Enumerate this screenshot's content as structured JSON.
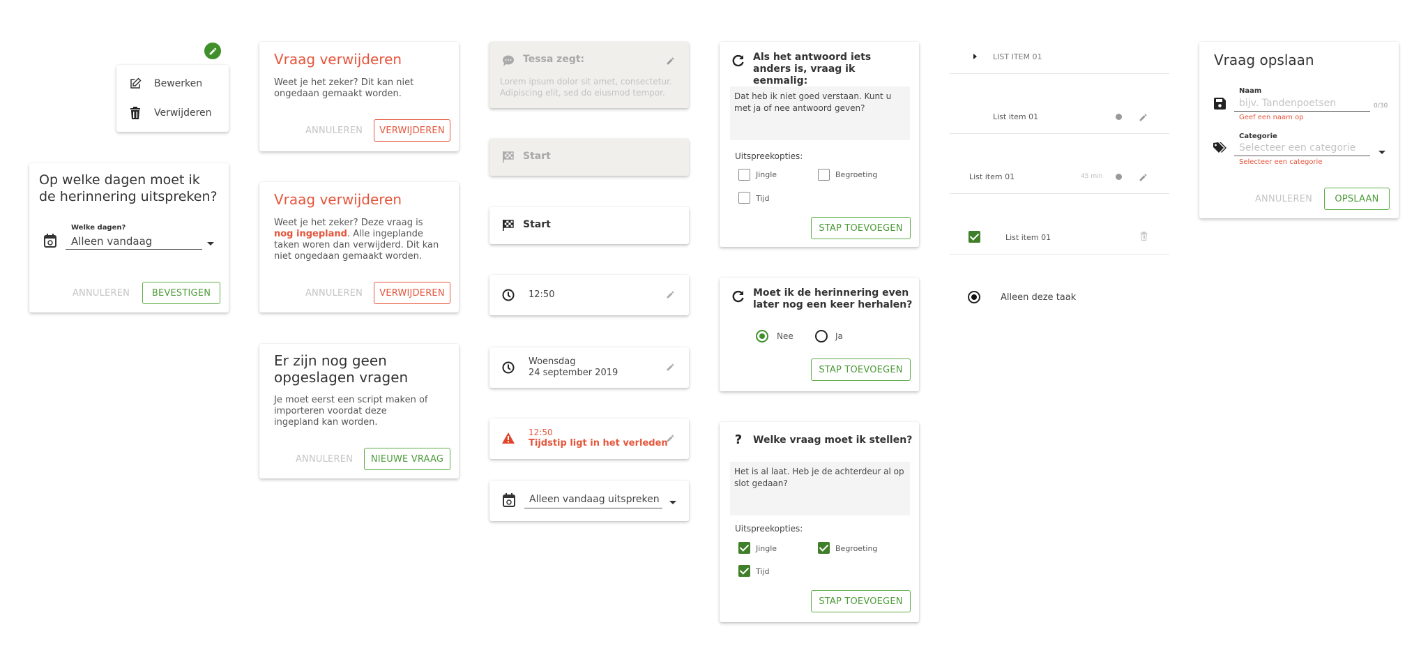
{
  "colors": {
    "accent_green": "#4c9a38",
    "checkbox_green": "#3f7f2a",
    "danger_red": "#e5553b",
    "grey_card": "#f0efec"
  },
  "context_menu": {
    "fab_icon": "pencil-icon",
    "items": [
      {
        "label": "Bewerken",
        "icon": "edit-icon"
      },
      {
        "label": "Verwijderen",
        "icon": "trash-icon"
      }
    ]
  },
  "days_dialog": {
    "title": "Op welke dagen moet ik de herinnering uitspreken?",
    "field_label": "Welke dagen?",
    "field_value": "Alleen vandaag",
    "icon": "calendar-sync-icon",
    "cancel_label": "ANNULEREN",
    "confirm_label": "BEVESTIGEN"
  },
  "delete_dialog_1": {
    "title": "Vraag verwijderen",
    "body": "Weet je het zeker? Dit kan niet ongedaan gemaakt worden.",
    "cancel_label": "ANNULEREN",
    "confirm_label": "VERWIJDEREN"
  },
  "delete_dialog_2": {
    "title": "Vraag verwijderen",
    "body_before": "Weet je het zeker? Deze vraag is ",
    "body_highlight": "nog ingepland",
    "body_after": ". Alle ingeplande taken woren dan verwijderd. Dit kan niet ongedaan gemaakt worden.",
    "cancel_label": "ANNULEREN",
    "confirm_label": "VERWIJDEREN"
  },
  "empty_dialog": {
    "title": "Er zijn nog geen opgeslagen vragen",
    "body": "Je moet eerst een script maken of importeren voordat deze ingepland kan worden.",
    "cancel_label": "ANNULEREN",
    "confirm_label": "NIEUWE VRAAG"
  },
  "step_cards": {
    "tessa": {
      "title": "Tessa zegt:",
      "body": "Lorem ipsum dolor sit amet, consectetur. Adipiscing elit, sed do eiusmod tempor."
    },
    "start_disabled": {
      "label": "Start"
    },
    "start": {
      "label": "Start"
    },
    "time": {
      "value": "12:50"
    },
    "date": {
      "day": "Woensdag",
      "date": "24 september 2019"
    },
    "time_error": {
      "value": "12:50",
      "error": "Tijdstip ligt in het verleden"
    },
    "repeat_select": {
      "value": "Alleen vandaag uitspreken"
    }
  },
  "fallback_card": {
    "title": "Als het antwoord iets anders is, vraag ik eenmalig:",
    "text": "Dat heb ik niet goed verstaan. Kunt u met ja of nee antwoord geven?",
    "options_label": "Uitspreekopties:",
    "options": [
      {
        "label": "Jingle",
        "checked": false
      },
      {
        "label": "Begroeting",
        "checked": false
      },
      {
        "label": "Tijd",
        "checked": false
      }
    ],
    "button_label": "STAP TOEVOEGEN"
  },
  "repeat_card": {
    "title": "Moet ik de herinnering even later nog een keer herhalen?",
    "options": [
      {
        "label": "Nee",
        "selected": true
      },
      {
        "label": "Ja",
        "selected": false
      }
    ],
    "button_label": "STAP TOEVOEGEN"
  },
  "question_card": {
    "title": "Welke vraag moet ik stellen?",
    "text": "Het is al laat. Heb je de achterdeur al op slot gedaan?",
    "options_label": "Uitspreekopties:",
    "options": [
      {
        "label": "Jingle",
        "checked": true
      },
      {
        "label": "Begroeting",
        "checked": true
      },
      {
        "label": "Tijd",
        "checked": true
      }
    ],
    "button_label": "STAP TOEVOEGEN"
  },
  "list_items": {
    "header": "LIST ITEM 01",
    "item_with_actions": "List item 01",
    "item_with_duration": "List item 01",
    "duration": "45 min",
    "checked_item": "List item 01",
    "radio_item": "Alleen deze taak"
  },
  "save_dialog": {
    "title": "Vraag opslaan",
    "name_label": "Naam",
    "name_placeholder": "bijv. Tandenpoetsen",
    "name_counter": "0/30",
    "name_error": "Geef een naam op",
    "category_label": "Categorie",
    "category_placeholder": "Selecteer een categorie",
    "category_error": "Selecteer een categorie",
    "cancel_label": "ANNULEREN",
    "confirm_label": "OPSLAAN"
  }
}
